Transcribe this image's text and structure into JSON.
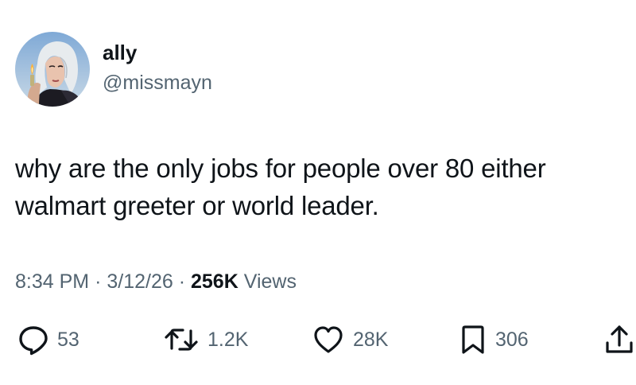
{
  "author": {
    "display_name": "ally",
    "handle": "@missmayn"
  },
  "tweet": {
    "text_lines": [
      "why are the only jobs for people over 80 either",
      "walmart greeter or world leader."
    ]
  },
  "meta": {
    "time": "8:34 PM",
    "separator": "·",
    "date": "3/12/26",
    "views_count": "256K",
    "views_label": "Views"
  },
  "actions": {
    "reply": {
      "icon": "reply-bubble-icon",
      "count": "53"
    },
    "repost": {
      "icon": "repost-icon",
      "count": "1.2K"
    },
    "like": {
      "icon": "heart-icon",
      "count": "28K"
    },
    "bookmark": {
      "icon": "bookmark-icon",
      "count": "306"
    },
    "share": {
      "icon": "share-icon"
    }
  },
  "colors": {
    "primary_text": "#0f1419",
    "secondary_text": "#536471",
    "background": "#ffffff"
  }
}
